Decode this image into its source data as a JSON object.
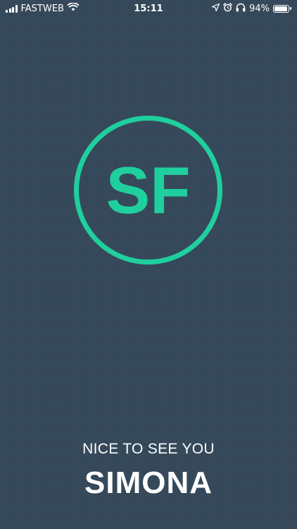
{
  "status_bar": {
    "carrier": "FASTWEB",
    "time": "15:11",
    "battery_percent": "94%",
    "battery_level": 0.94,
    "icons": [
      "signal-icon",
      "wifi-icon",
      "location-icon",
      "alarm-icon",
      "headphones-icon",
      "battery-icon"
    ]
  },
  "logo": {
    "initials": "SF",
    "color": "#1fcf9d"
  },
  "welcome": {
    "greeting": "NICE TO SEE YOU",
    "name": "SIMONA"
  },
  "colors": {
    "background": "#36495a",
    "accent": "#1fcf9d",
    "text": "#ffffff"
  }
}
